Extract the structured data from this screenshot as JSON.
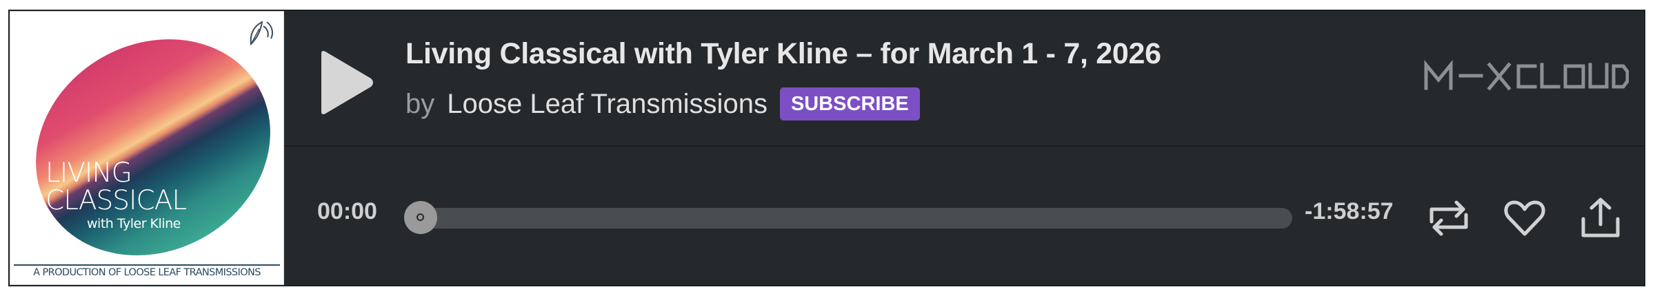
{
  "artwork": {
    "title_line1": "LIVING",
    "title_line2": "CLASSICAL",
    "subtitle": "with Tyler Kline",
    "credit": "A PRODUCTION OF LOOSE LEAF TRANSMISSIONS",
    "icon": "leaf-icon"
  },
  "player": {
    "play_icon": "play-icon",
    "show_title": "Living Classical with Tyler Kline – for March 1 - 7, 2026",
    "by_word": "by",
    "artist": "Loose Leaf Transmissions",
    "subscribe_label": "SUBSCRIBE",
    "logo_text": "MIXCLOUD",
    "elapsed": "00:00",
    "remaining": "-1:58:57",
    "progress": 0,
    "actions": [
      "repost-icon",
      "heart-icon",
      "share-icon"
    ]
  },
  "colors": {
    "background": "#26292c",
    "accent": "#7c4fc4",
    "text": "#e7e7e7",
    "muted": "#9b9ea0",
    "track": "#4a4d50"
  }
}
